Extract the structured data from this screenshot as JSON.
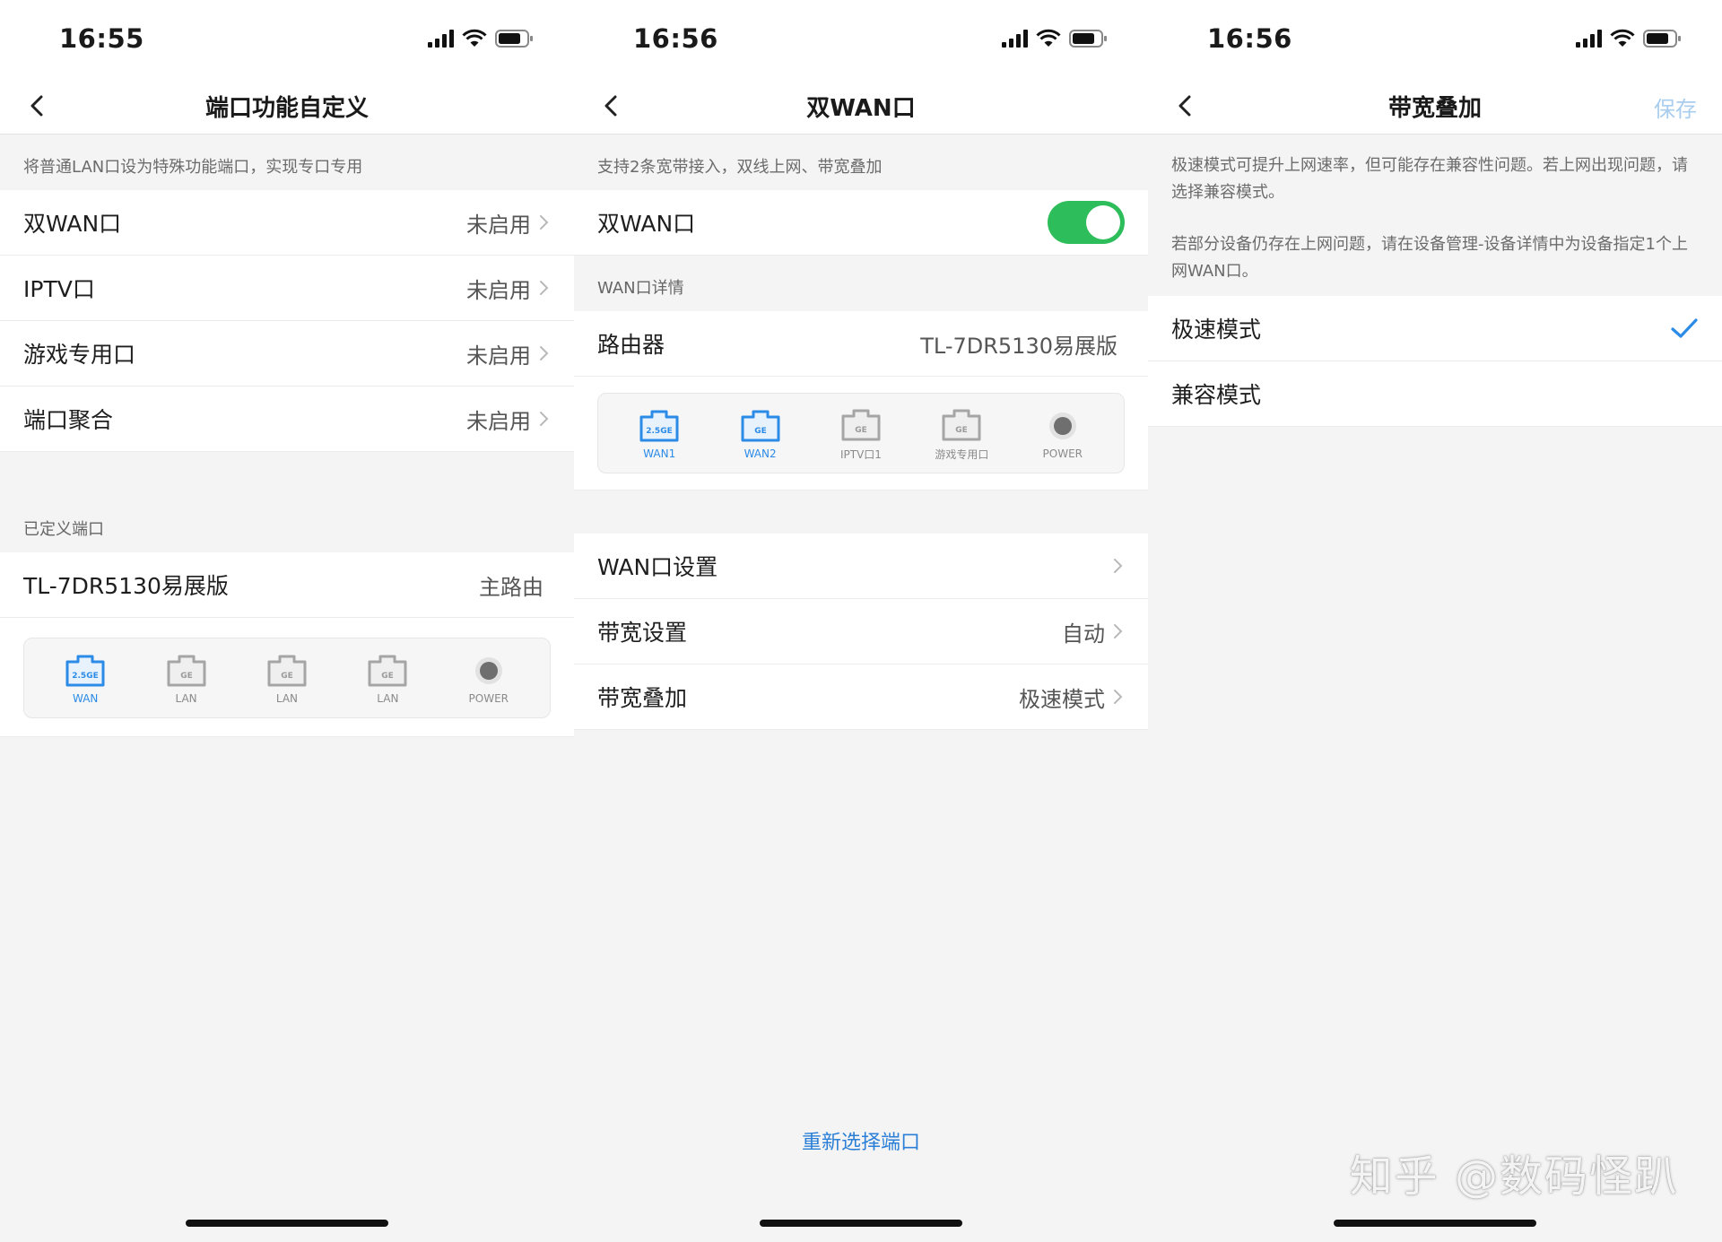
{
  "colors": {
    "accent": "#2b8be6",
    "toggle_on": "#2dbd5a",
    "save_disabled": "#a9cdee"
  },
  "screens": [
    {
      "status_time": "16:55",
      "title": "端口功能自定义",
      "hint": "将普通LAN口设为特殊功能端口，实现专口专用",
      "rows": [
        {
          "label": "双WAN口",
          "value": "未启用"
        },
        {
          "label": "IPTV口",
          "value": "未启用"
        },
        {
          "label": "游戏专用口",
          "value": "未启用"
        },
        {
          "label": "端口聚合",
          "value": "未启用"
        }
      ],
      "section_label": "已定义端口",
      "device_row": {
        "label": "TL-7DR5130易展版",
        "value": "主路由"
      },
      "ports": [
        {
          "badge": "2.5GE",
          "label": "WAN",
          "active": true
        },
        {
          "badge": "GE",
          "label": "LAN",
          "active": false
        },
        {
          "badge": "GE",
          "label": "LAN",
          "active": false
        },
        {
          "badge": "GE",
          "label": "LAN",
          "active": false
        },
        {
          "badge": "",
          "label": "POWER",
          "active": false
        }
      ]
    },
    {
      "status_time": "16:56",
      "title": "双WAN口",
      "hint": "支持2条宽带接入，双线上网、带宽叠加",
      "toggle_row": {
        "label": "双WAN口",
        "state": "on"
      },
      "section_label": "WAN口详情",
      "device_row": {
        "label": "路由器",
        "value": "TL-7DR5130易展版"
      },
      "ports": [
        {
          "badge": "2.5GE",
          "label": "WAN1",
          "active": true
        },
        {
          "badge": "GE",
          "label": "WAN2",
          "active": true
        },
        {
          "badge": "GE",
          "label": "IPTV口1",
          "active": false
        },
        {
          "badge": "GE",
          "label": "游戏专用口",
          "active": false
        },
        {
          "badge": "",
          "label": "POWER",
          "active": false
        }
      ],
      "rows": [
        {
          "label": "WAN口设置",
          "value": ""
        },
        {
          "label": "带宽设置",
          "value": "自动"
        },
        {
          "label": "带宽叠加",
          "value": "极速模式"
        }
      ],
      "bottom_link": "重新选择端口"
    },
    {
      "status_time": "16:56",
      "title": "带宽叠加",
      "save_label": "保存",
      "hint1": "极速模式可提升上网速率，但可能存在兼容性问题。若上网出现问题，请选择兼容模式。",
      "hint2": "若部分设备仍存在上网问题，请在设备管理-设备详情中为设备指定1个上网WAN口。",
      "options": [
        {
          "label": "极速模式",
          "selected": true
        },
        {
          "label": "兼容模式",
          "selected": false
        }
      ]
    }
  ],
  "watermark": "知乎 @数码怪趴"
}
